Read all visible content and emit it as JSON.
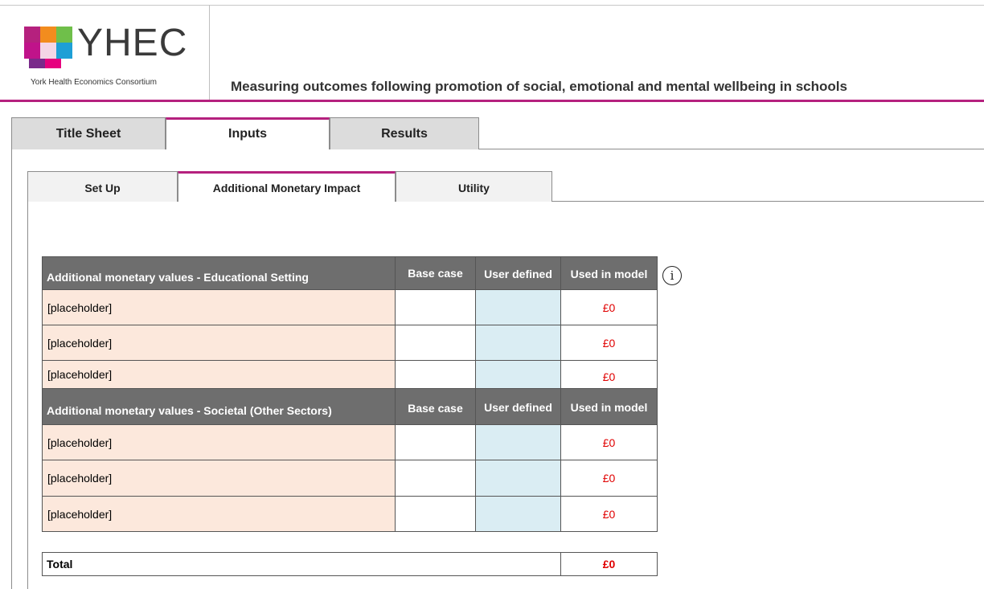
{
  "header": {
    "logo_text": "YHEC",
    "logo_subtitle": "York Health Economics Consortium",
    "app_title": "Measuring outcomes following promotion of social, emotional and mental wellbeing in schools",
    "brand_color": "#b5217e"
  },
  "main_tabs": [
    {
      "label": "Title Sheet",
      "active": false
    },
    {
      "label": "Inputs",
      "active": true
    },
    {
      "label": "Results",
      "active": false
    }
  ],
  "sub_tabs": [
    {
      "label": "Set Up",
      "active": false
    },
    {
      "label": "Additional Monetary Impact",
      "active": true
    },
    {
      "label": "Utility",
      "active": false
    }
  ],
  "table": {
    "info_icon": "info-icon",
    "sections": [
      {
        "title": "Additional monetary values - Educational Setting",
        "col_base": "Base case",
        "col_user": "User defined",
        "col_used": "Used in model",
        "rows": [
          {
            "label": "[placeholder]",
            "base": "",
            "user": "",
            "used": "£0"
          },
          {
            "label": "[placeholder]",
            "base": "",
            "user": "",
            "used": "£0"
          },
          {
            "label": "[placeholder]",
            "base": "",
            "user": "",
            "used": "£0"
          }
        ]
      },
      {
        "title": "Additional monetary values - Societal (Other Sectors)",
        "col_base": "Base case",
        "col_user": "User defined",
        "col_used": "Used in model",
        "rows": [
          {
            "label": "[placeholder]",
            "base": "",
            "user": "",
            "used": "£0"
          },
          {
            "label": "[placeholder]",
            "base": "",
            "user": "",
            "used": "£0"
          },
          {
            "label": "[placeholder]",
            "base": "",
            "user": "",
            "used": "£0"
          }
        ]
      }
    ],
    "total_label": "Total",
    "total_value": "£0"
  }
}
